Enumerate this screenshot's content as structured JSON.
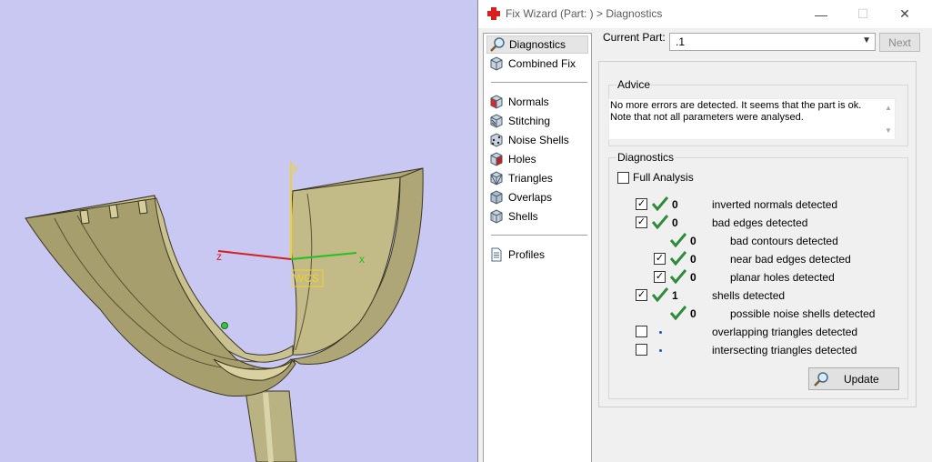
{
  "window": {
    "title": "Fix Wizard (Part: ) > Diagnostics",
    "minimize_glyph": "—",
    "maximize_glyph": "☐",
    "close_glyph": "✕"
  },
  "viewport": {
    "axis_y": "y",
    "axis_z": "z",
    "axis_x": "x",
    "wcs": "WCS",
    "colors": {
      "background": "#c8c8f2",
      "model": "#b3aa78",
      "x_axis": "#22c022",
      "y_axis": "#f2d22e",
      "z_axis": "#d22020"
    }
  },
  "nav": {
    "items": [
      {
        "label": "Diagnostics",
        "icon": "magnifier-icon"
      },
      {
        "label": "Combined Fix",
        "icon": "cube-icon"
      },
      {
        "label": "Normals",
        "icon": "normals-cube-icon"
      },
      {
        "label": "Stitching",
        "icon": "stitching-cube-icon"
      },
      {
        "label": "Noise Shells",
        "icon": "noise-cube-icon"
      },
      {
        "label": "Holes",
        "icon": "holes-cube-icon"
      },
      {
        "label": "Triangles",
        "icon": "triangles-cube-icon"
      },
      {
        "label": "Overlaps",
        "icon": "overlaps-cube-icon"
      },
      {
        "label": "Shells",
        "icon": "shells-cube-icon"
      },
      {
        "label": "Profiles",
        "icon": "document-icon"
      }
    ]
  },
  "part": {
    "label": "Current Part:",
    "value": ".1",
    "next_label": "Next"
  },
  "advice": {
    "title": "Advice",
    "text_line1": "No more errors are detected. It seems that the part is ok.",
    "text_line2": "Note that not all parameters were analysed."
  },
  "diagnostics": {
    "title": "Diagnostics",
    "full_analysis_label": "Full Analysis",
    "rows": [
      {
        "count": "0",
        "label": "inverted normals detected"
      },
      {
        "count": "0",
        "label": "bad edges detected"
      },
      {
        "count": "0",
        "label": "bad contours detected"
      },
      {
        "count": "0",
        "label": "near bad edges detected"
      },
      {
        "count": "0",
        "label": "planar holes detected"
      },
      {
        "count": "1",
        "label": "shells detected"
      },
      {
        "count": "0",
        "label": "possible noise shells detected"
      },
      {
        "count": "",
        "label": "overlapping triangles detected"
      },
      {
        "count": "",
        "label": "intersecting triangles detected"
      }
    ],
    "check_color": "#2e8b3a"
  },
  "update_label": "Update"
}
